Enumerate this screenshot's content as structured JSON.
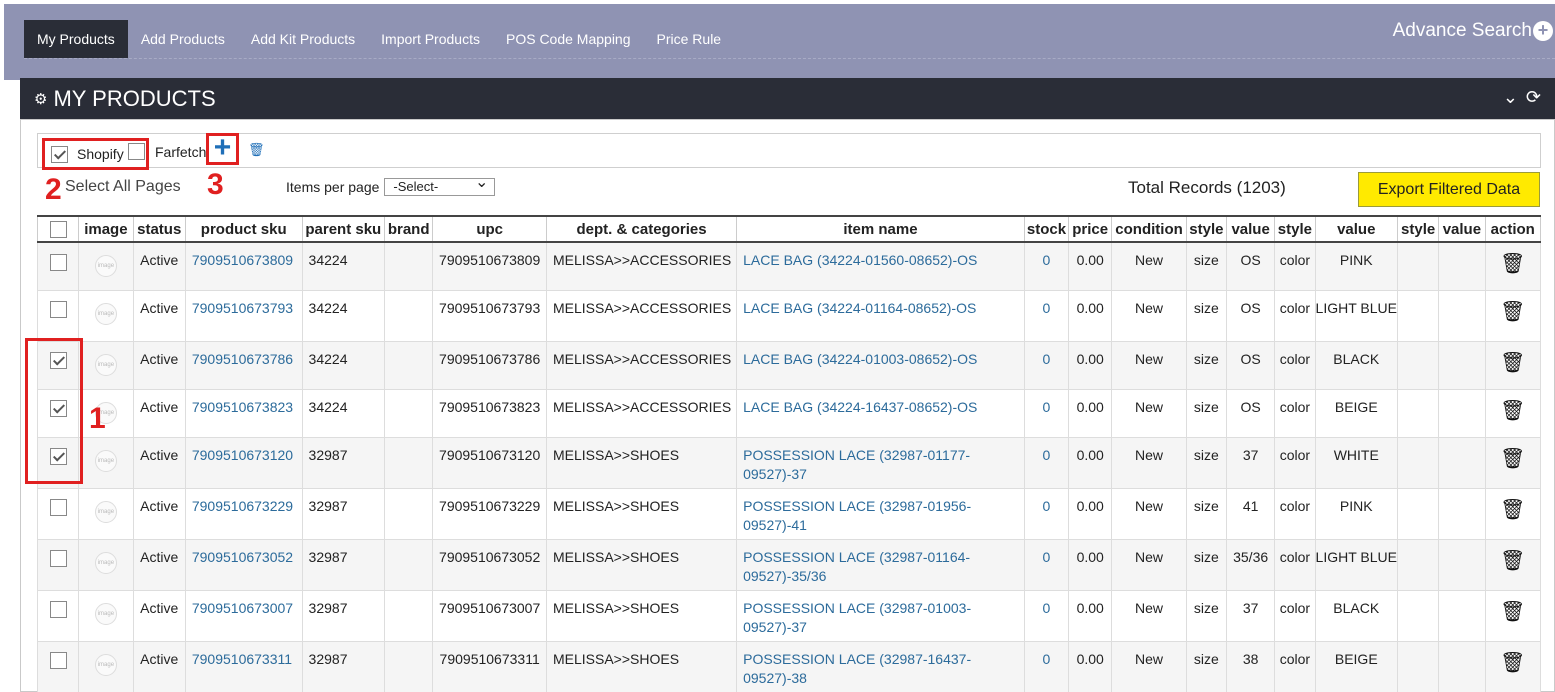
{
  "nav": {
    "items": [
      "My Products",
      "Add Products",
      "Add Kit Products",
      "Import Products",
      "POS Code Mapping",
      "Price Rule"
    ],
    "active": "My Products",
    "advance_search": "Advance Search"
  },
  "panel": {
    "title": "MY PRODUCTS"
  },
  "channels": {
    "shopify": "Shopify",
    "farfetch": "Farfetch"
  },
  "annotations": {
    "one": "1",
    "two": "2",
    "three": "3"
  },
  "toolbar": {
    "select_all_pages": "Select All Pages",
    "items_per_page_label": "Items per page",
    "items_per_page_value": "-Select-",
    "total_records": "Total Records (1203)",
    "export_button": "Export Filtered Data"
  },
  "table": {
    "columns": [
      "",
      "image",
      "status",
      "product sku",
      "parent sku",
      "brand",
      "upc",
      "dept. & categories",
      "item name",
      "stock",
      "price",
      "condition",
      "style",
      "value",
      "style",
      "value",
      "style",
      "value",
      "action"
    ],
    "rows": [
      {
        "checked": false,
        "status": "Active",
        "sku": "7909510673809",
        "parent": "34224",
        "brand": "",
        "upc": "7909510673809",
        "dept": "MELISSA>>ACCESSORIES",
        "name": "LACE BAG (34224-01560-08652)-OS",
        "stock": "0",
        "price": "0.00",
        "condition": "New",
        "style1": "size",
        "value1": "OS",
        "style2": "color",
        "value2": "PINK",
        "style3": "",
        "value3": "",
        "h": 48
      },
      {
        "checked": false,
        "status": "Active",
        "sku": "7909510673793",
        "parent": "34224",
        "brand": "",
        "upc": "7909510673793",
        "dept": "MELISSA>>ACCESSORIES",
        "name": "LACE BAG (34224-01164-08652)-OS",
        "stock": "0",
        "price": "0.00",
        "condition": "New",
        "style1": "size",
        "value1": "OS",
        "style2": "color",
        "value2": "LIGHT BLUE",
        "style3": "",
        "value3": "",
        "h": 51
      },
      {
        "checked": true,
        "status": "Active",
        "sku": "7909510673786",
        "parent": "34224",
        "brand": "",
        "upc": "7909510673786",
        "dept": "MELISSA>>ACCESSORIES",
        "name": "LACE BAG (34224-01003-08652)-OS",
        "stock": "0",
        "price": "0.00",
        "condition": "New",
        "style1": "size",
        "value1": "OS",
        "style2": "color",
        "value2": "BLACK",
        "style3": "",
        "value3": "",
        "h": 48
      },
      {
        "checked": true,
        "status": "Active",
        "sku": "7909510673823",
        "parent": "34224",
        "brand": "",
        "upc": "7909510673823",
        "dept": "MELISSA>>ACCESSORIES",
        "name": "LACE BAG (34224-16437-08652)-OS",
        "stock": "0",
        "price": "0.00",
        "condition": "New",
        "style1": "size",
        "value1": "OS",
        "style2": "color",
        "value2": "BEIGE",
        "style3": "",
        "value3": "",
        "h": 48
      },
      {
        "checked": true,
        "status": "Active",
        "sku": "7909510673120",
        "parent": "32987",
        "brand": "",
        "upc": "7909510673120",
        "dept": "MELISSA>>SHOES",
        "name": "POSSESSION LACE (32987-01177-09527)-37",
        "stock": "0",
        "price": "0.00",
        "condition": "New",
        "style1": "size",
        "value1": "37",
        "style2": "color",
        "value2": "WHITE",
        "style3": "",
        "value3": "",
        "h": 51
      },
      {
        "checked": false,
        "status": "Active",
        "sku": "7909510673229",
        "parent": "32987",
        "brand": "",
        "upc": "7909510673229",
        "dept": "MELISSA>>SHOES",
        "name": "POSSESSION LACE (32987-01956-09527)-41",
        "stock": "0",
        "price": "0.00",
        "condition": "New",
        "style1": "size",
        "value1": "41",
        "style2": "color",
        "value2": "PINK",
        "style3": "",
        "value3": "",
        "h": 51
      },
      {
        "checked": false,
        "status": "Active",
        "sku": "7909510673052",
        "parent": "32987",
        "brand": "",
        "upc": "7909510673052",
        "dept": "MELISSA>>SHOES",
        "name": "POSSESSION LACE (32987-01164-09527)-35/36",
        "stock": "0",
        "price": "0.00",
        "condition": "New",
        "style1": "size",
        "value1": "35/36",
        "style2": "color",
        "value2": "LIGHT BLUE",
        "style3": "",
        "value3": "",
        "h": 51
      },
      {
        "checked": false,
        "status": "Active",
        "sku": "7909510673007",
        "parent": "32987",
        "brand": "",
        "upc": "7909510673007",
        "dept": "MELISSA>>SHOES",
        "name": "POSSESSION LACE (32987-01003-09527)-37",
        "stock": "0",
        "price": "0.00",
        "condition": "New",
        "style1": "size",
        "value1": "37",
        "style2": "color",
        "value2": "BLACK",
        "style3": "",
        "value3": "",
        "h": 51
      },
      {
        "checked": false,
        "status": "Active",
        "sku": "7909510673311",
        "parent": "32987",
        "brand": "",
        "upc": "7909510673311",
        "dept": "MELISSA>>SHOES",
        "name": "POSSESSION LACE (32987-16437-09527)-38",
        "stock": "0",
        "price": "0.00",
        "condition": "New",
        "style1": "size",
        "value1": "38",
        "style2": "color",
        "value2": "BEIGE",
        "style3": "",
        "value3": "",
        "h": 51
      }
    ]
  }
}
